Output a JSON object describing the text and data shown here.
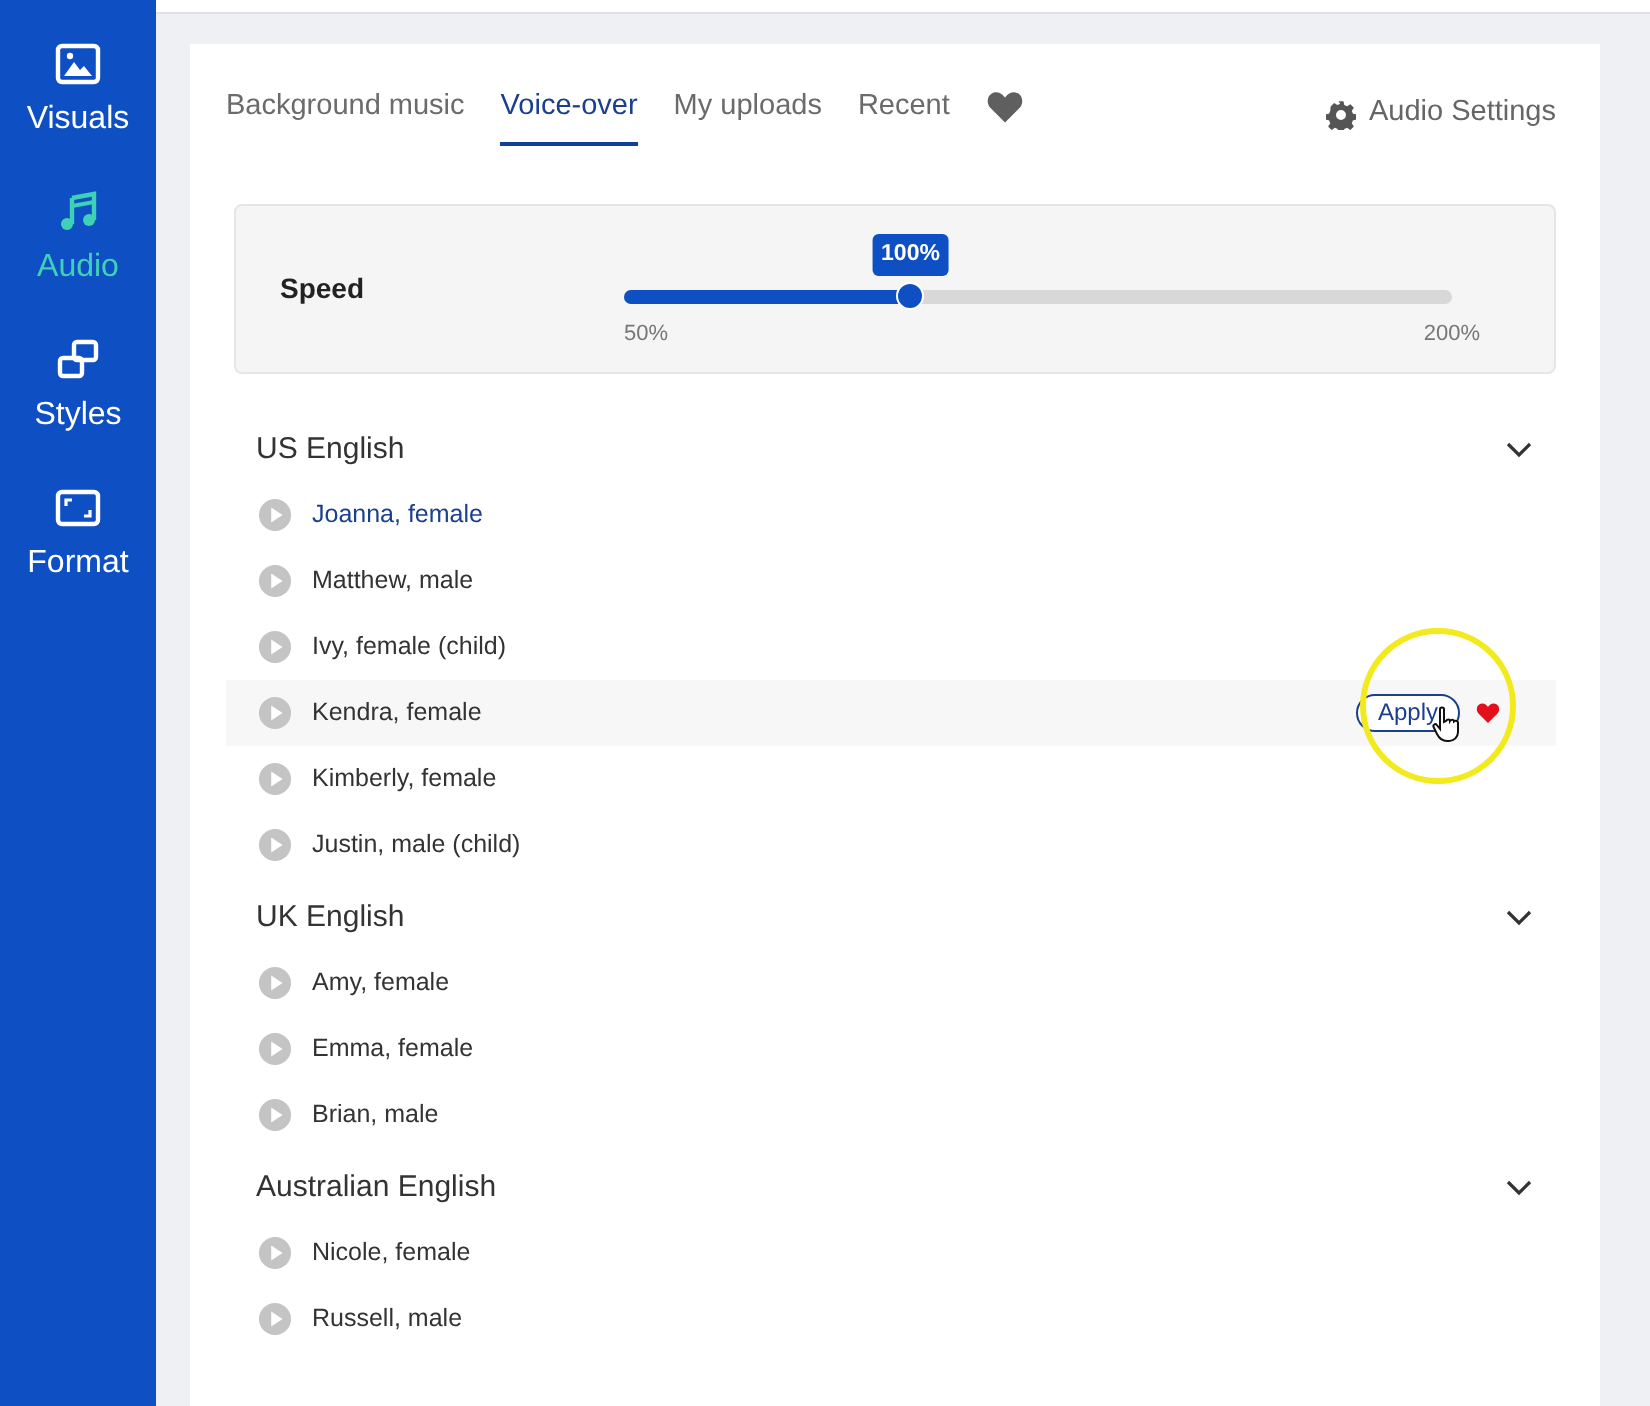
{
  "sidebar": {
    "items": [
      {
        "label": "Visuals",
        "selected": false
      },
      {
        "label": "Audio",
        "selected": true
      },
      {
        "label": "Styles",
        "selected": false
      },
      {
        "label": "Format",
        "selected": false
      }
    ]
  },
  "tabs": [
    {
      "label": "Background music",
      "selected": false
    },
    {
      "label": "Voice-over",
      "selected": true
    },
    {
      "label": "My uploads",
      "selected": false
    },
    {
      "label": "Recent",
      "selected": false
    }
  ],
  "settings_link": "Audio Settings",
  "speed": {
    "label": "Speed",
    "value": "100%",
    "min": "50%",
    "max": "200%",
    "level": 0.346
  },
  "groups": [
    {
      "title": "US English",
      "expanded": true,
      "voices": [
        {
          "name": "Joanna, female",
          "selected": true,
          "hovered": false
        },
        {
          "name": "Matthew, male",
          "selected": false,
          "hovered": false
        },
        {
          "name": "Ivy, female (child)",
          "selected": false,
          "hovered": false
        },
        {
          "name": "Kendra, female",
          "selected": false,
          "hovered": true,
          "action": "Apply"
        },
        {
          "name": "Kimberly, female",
          "selected": false,
          "hovered": false
        },
        {
          "name": "Justin, male (child)",
          "selected": false,
          "hovered": false
        }
      ]
    },
    {
      "title": "UK English",
      "expanded": true,
      "voices": [
        {
          "name": "Amy, female",
          "selected": false,
          "hovered": false
        },
        {
          "name": "Emma, female",
          "selected": false,
          "hovered": false
        },
        {
          "name": "Brian, male",
          "selected": false,
          "hovered": false
        }
      ]
    },
    {
      "title": "Australian English",
      "expanded": true,
      "voices": [
        {
          "name": "Nicole, female",
          "selected": false,
          "hovered": false
        },
        {
          "name": "Russell, male",
          "selected": false,
          "hovered": false
        }
      ]
    }
  ]
}
